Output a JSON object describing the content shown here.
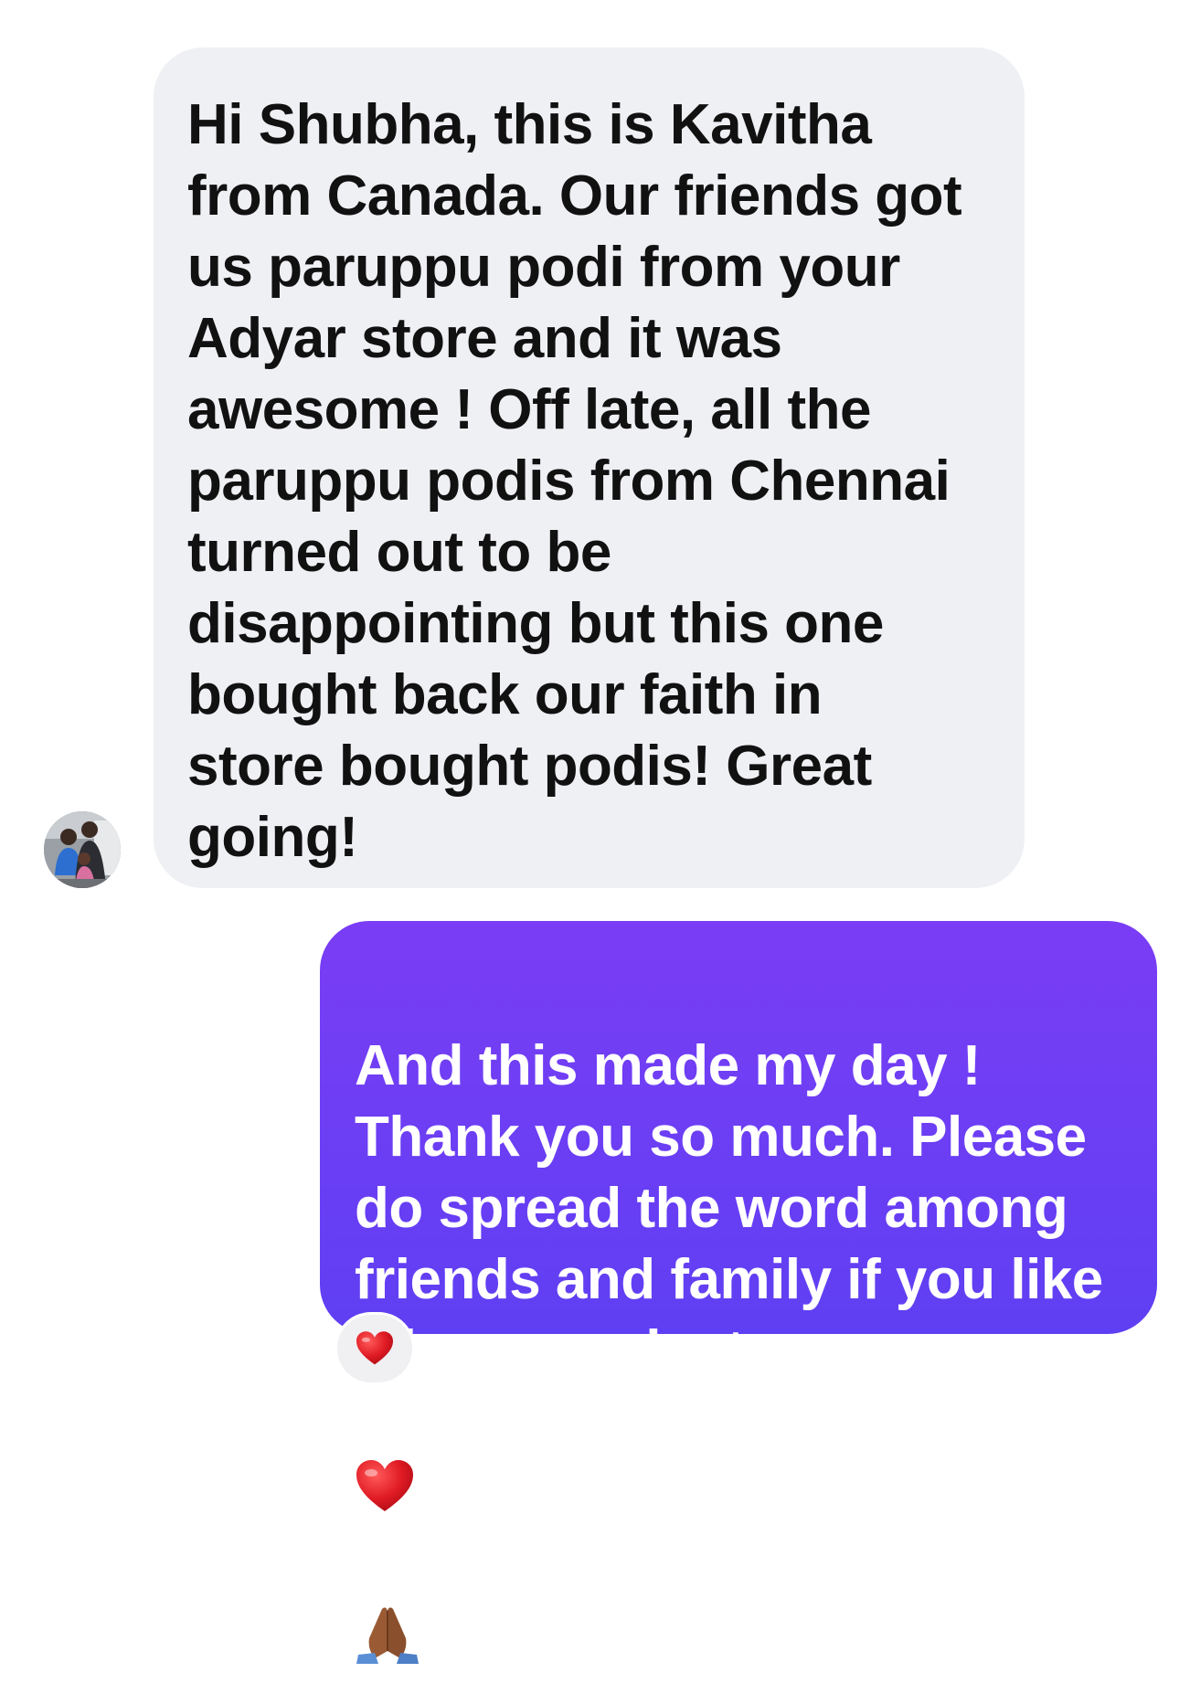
{
  "messages": [
    {
      "direction": "incoming",
      "text": "Hi Shubha, this is Kavitha\nfrom Canada. Our friends got\nus paruppu podi from your\nAdyar store and it was\nawesome ! Off late,  all the\nparuppu podis from Chennai\nturned out to be\ndisappointing but this one\nbought back our faith in\nstore bought podis! Great\ngoing!",
      "bubble_color": "#eff0f4",
      "text_color": "#111111",
      "avatar_icon": "contact-photo-icon"
    },
    {
      "direction": "outgoing",
      "text": "And this made my day !\nThank you so much. Please\ndo spread the word among\nfriends and family if you like\nall our products",
      "trailing_emojis": [
        "red-heart-icon",
        "folded-hands-icon"
      ],
      "bubble_color": "#6a3ef4",
      "text_color": "#ffffff",
      "reaction": "red-heart-icon"
    }
  ]
}
